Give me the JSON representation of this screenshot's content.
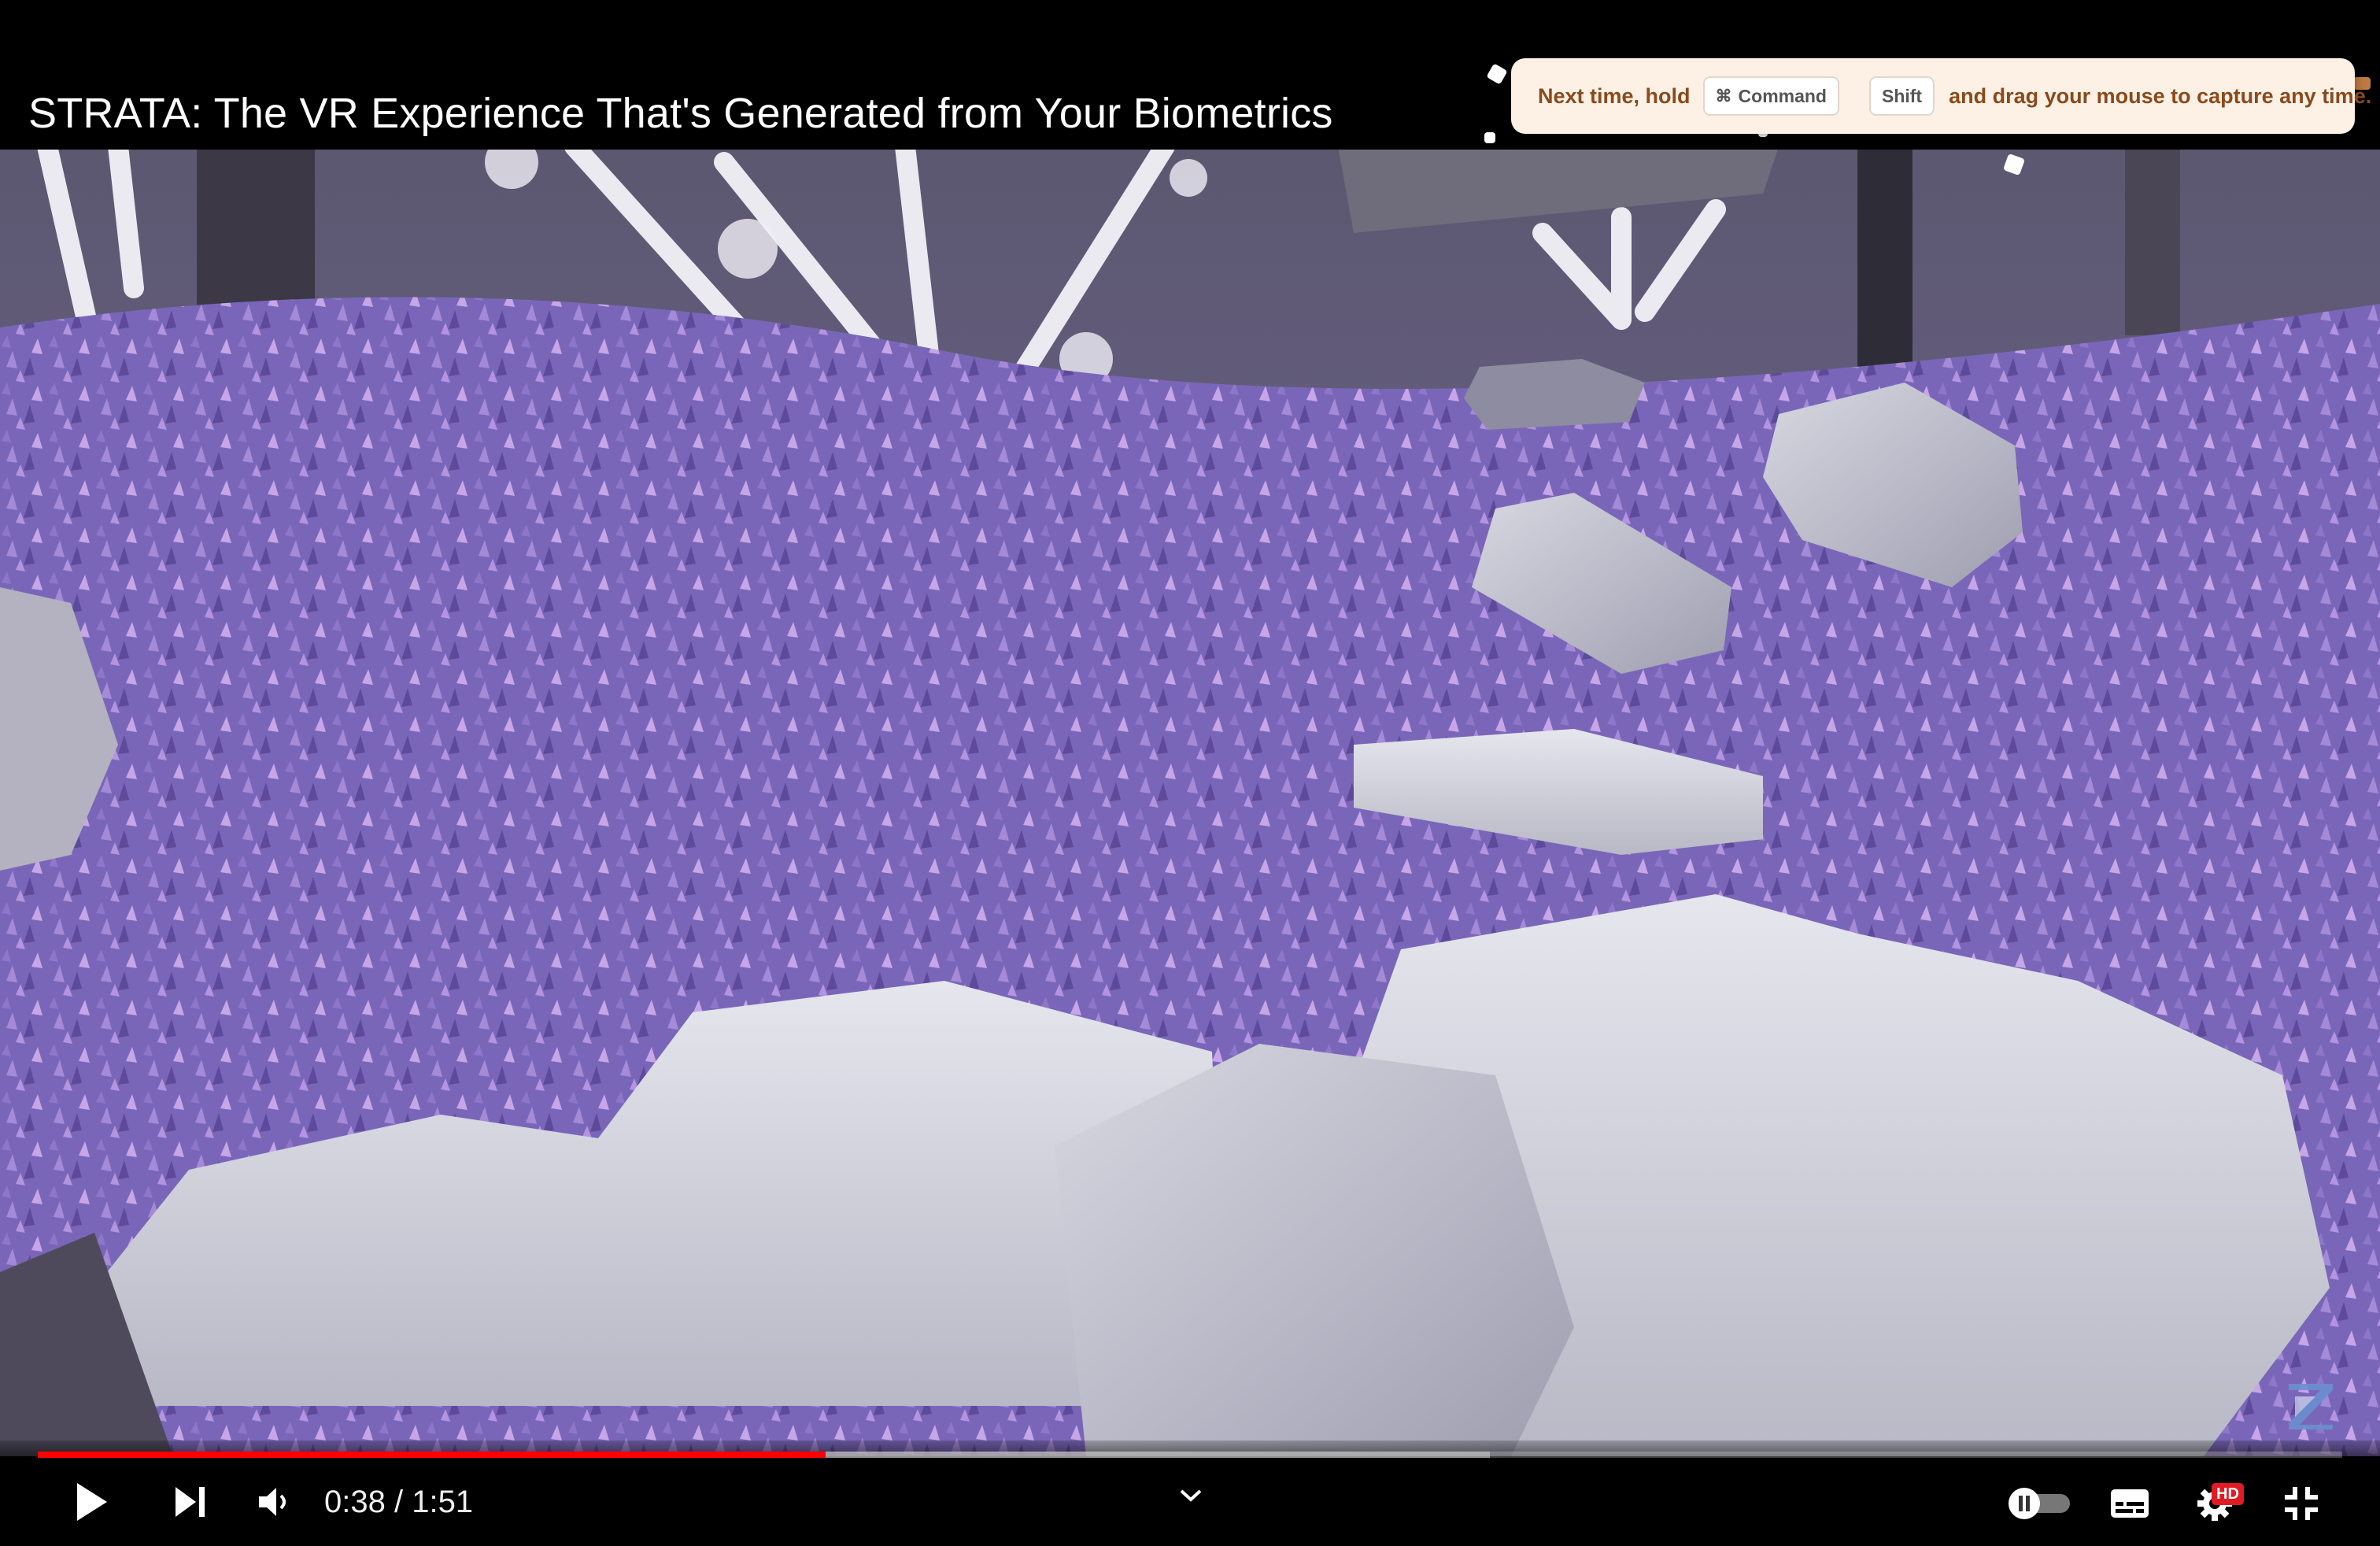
{
  "video": {
    "title": "STRATA: The VR Experience That's Generated from Your Biometrics"
  },
  "toast": {
    "prefix": "Next time, hold",
    "key1_symbol": "⌘",
    "key1_label": "Command",
    "key2_label": "Shift",
    "suffix": "and drag your mouse to capture any time."
  },
  "player": {
    "current_time": "0:38",
    "duration": "1:51",
    "time_separator": " / ",
    "progress_played": 0.342,
    "progress_buffered": 0.63,
    "hd_label": "HD",
    "autoplay_paused": true
  },
  "icons": {
    "play": "play-icon",
    "next": "skip-next-icon",
    "volume": "volume-icon",
    "chevron": "chevron-down-icon",
    "autoplay": "autoplay-toggle-icon",
    "subtitles": "subtitles-icon",
    "settings": "settings-gear-icon",
    "exit_fullscreen": "exit-fullscreen-icon"
  },
  "colors": {
    "progress": "#ff0000",
    "toast_bg": "#fdf1e6",
    "toast_text": "#8a4a1c",
    "hd_badge": "#e01b24"
  }
}
